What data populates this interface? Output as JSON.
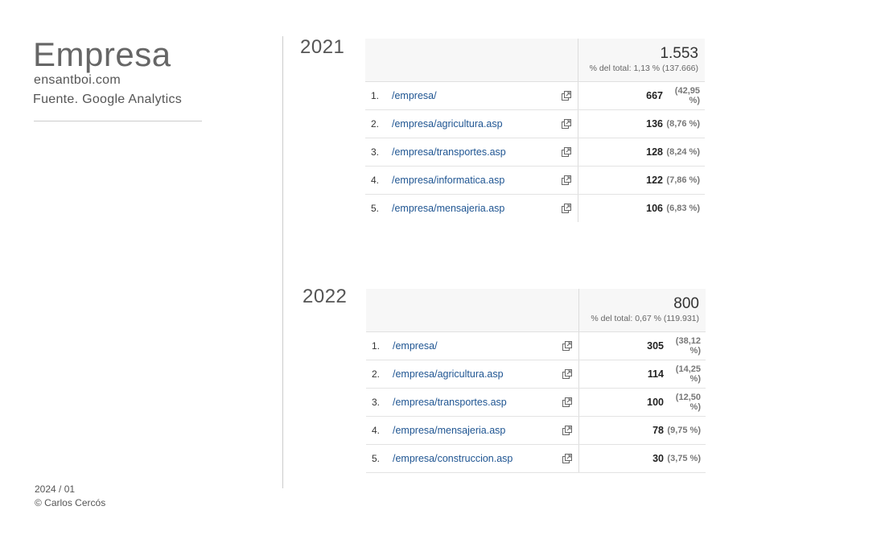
{
  "header": {
    "title": "Empresa",
    "site": "ensantboi.com",
    "source": "Fuente. Google Analytics"
  },
  "footer": {
    "date": "2024 / 01",
    "author": "© Carlos Cercós"
  },
  "reports": [
    {
      "year": "2021",
      "total": "1.553",
      "total_pct": "% del total: 1,13 % (137.666)",
      "rows": [
        {
          "num": "1.",
          "path": "/empresa/",
          "value": "667",
          "pct": "(42,95 %)"
        },
        {
          "num": "2.",
          "path": "/empresa/agricultura.asp",
          "value": "136",
          "pct": "(8,76 %)"
        },
        {
          "num": "3.",
          "path": "/empresa/transportes.asp",
          "value": "128",
          "pct": "(8,24 %)"
        },
        {
          "num": "4.",
          "path": "/empresa/informatica.asp",
          "value": "122",
          "pct": "(7,86 %)"
        },
        {
          "num": "5.",
          "path": "/empresa/mensajeria.asp",
          "value": "106",
          "pct": "(6,83 %)"
        }
      ]
    },
    {
      "year": "2022",
      "total": "800",
      "total_pct": "% del total: 0,67 % (119.931)",
      "rows": [
        {
          "num": "1.",
          "path": "/empresa/",
          "value": "305",
          "pct": "(38,12 %)"
        },
        {
          "num": "2.",
          "path": "/empresa/agricultura.asp",
          "value": "114",
          "pct": "(14,25 %)"
        },
        {
          "num": "3.",
          "path": "/empresa/transportes.asp",
          "value": "100",
          "pct": "(12,50 %)"
        },
        {
          "num": "4.",
          "path": "/empresa/mensajeria.asp",
          "value": "78",
          "pct": "(9,75 %)"
        },
        {
          "num": "5.",
          "path": "/empresa/construccion.asp",
          "value": "30",
          "pct": "(3,75 %)"
        }
      ]
    }
  ],
  "icons": {
    "external_link": "external-link-icon"
  }
}
